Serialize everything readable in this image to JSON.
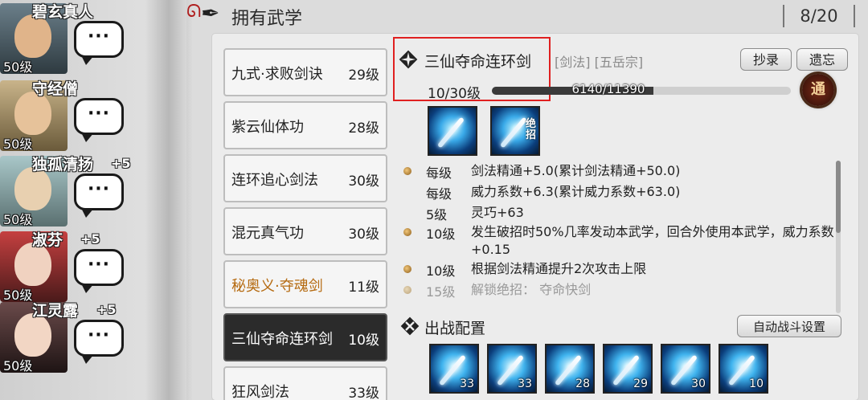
{
  "characters": [
    {
      "name": "碧玄真人",
      "level": "50级",
      "bonus": ""
    },
    {
      "name": "守经僧",
      "level": "50级",
      "bonus": ""
    },
    {
      "name": "独孤清扬",
      "level": "50级",
      "bonus": "+5"
    },
    {
      "name": "淑芬",
      "level": "50级",
      "bonus": "+5"
    },
    {
      "name": "江灵露",
      "level": "50级",
      "bonus": "+5"
    }
  ],
  "chat_bubble": "···",
  "header": {
    "title": "拥有武学",
    "count": "8/20"
  },
  "skills": [
    {
      "name": "九式·求败剑诀",
      "level": "29级"
    },
    {
      "name": "紫云仙体功",
      "level": "28级"
    },
    {
      "name": "连环追心剑法",
      "level": "30级"
    },
    {
      "name": "混元真气功",
      "level": "30级"
    },
    {
      "name": "秘奥义·夺魂剑",
      "level": "11级"
    },
    {
      "name": "三仙夺命连环剑",
      "level": "10级"
    },
    {
      "name": "狂风剑法",
      "level": "33级"
    }
  ],
  "detail": {
    "name": "三仙夺命连环剑",
    "tags": "[剑法] [五岳宗]",
    "copy_label": "抄录",
    "forget_label": "遗忘",
    "level_text": "10/30级",
    "exp_text": "6140/11390",
    "exp_ratio": 0.539,
    "badge": "通",
    "ult_label": "绝招",
    "effects": [
      {
        "label": "每级",
        "text": "剑法精通+5.0(累计剑法精通+50.0)",
        "bullet": true
      },
      {
        "label": "每级",
        "text": "威力系数+6.3(累计威力系数+63.0)",
        "bullet": false
      },
      {
        "label": "5级",
        "text": "灵巧+63",
        "bullet": false
      },
      {
        "label": "10级",
        "text": "发生破招时50%几率发动本武学，回合外使用本武学，威力系数+0.15",
        "bullet": true
      },
      {
        "label": "10级",
        "text": "根据剑法精通提升2次攻击上限",
        "bullet": true
      },
      {
        "label": "15级",
        "text": "解锁绝招：  夺命快剑",
        "bullet": true
      }
    ]
  },
  "battle": {
    "title": "出战配置",
    "auto_label": "自动战斗设置",
    "slots": [
      "33",
      "33",
      "28",
      "29",
      "30",
      "10"
    ]
  },
  "colors": {
    "highlight": "#e02020",
    "secret_skill": "#b56a10",
    "active_bg": "#2b2b2b"
  }
}
